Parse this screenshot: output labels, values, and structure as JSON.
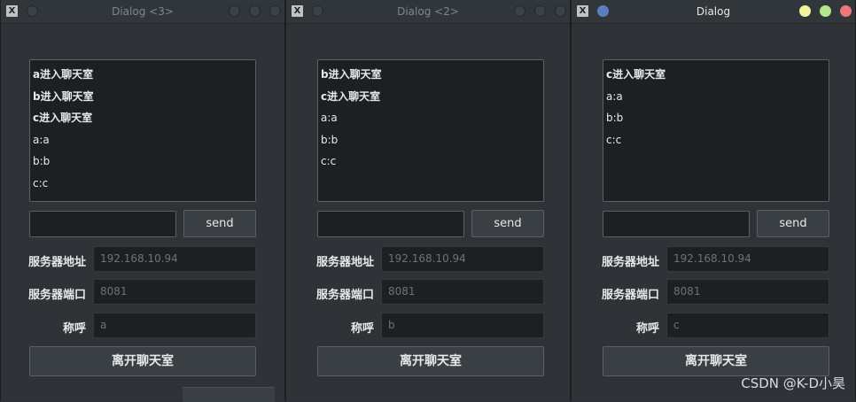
{
  "windows": [
    {
      "title": "Dialog <3>",
      "chat_lines": [
        {
          "text": "a进入聊天室",
          "bold": true
        },
        {
          "text": "b进入聊天室",
          "bold": true
        },
        {
          "text": "c进入聊天室",
          "bold": true
        },
        {
          "text": "a:a",
          "bold": false
        },
        {
          "text": "b:b",
          "bold": false
        },
        {
          "text": "c:c",
          "bold": false
        }
      ],
      "message_value": "",
      "send_label": "send",
      "server_address_label": "服务器地址",
      "server_address_value": "192.168.10.94",
      "server_port_label": "服务器端口",
      "server_port_value": "8081",
      "nickname_label": "称呼",
      "nickname_value": "a",
      "leave_label": "离开聊天室"
    },
    {
      "title": "Dialog <2>",
      "chat_lines": [
        {
          "text": "b进入聊天室",
          "bold": true
        },
        {
          "text": "c进入聊天室",
          "bold": true
        },
        {
          "text": "a:a",
          "bold": false
        },
        {
          "text": "b:b",
          "bold": false
        },
        {
          "text": "c:c",
          "bold": false
        }
      ],
      "message_value": "",
      "send_label": "send",
      "server_address_label": "服务器地址",
      "server_address_value": "192.168.10.94",
      "server_port_label": "服务器端口",
      "server_port_value": "8081",
      "nickname_label": "称呼",
      "nickname_value": "b",
      "leave_label": "离开聊天室"
    },
    {
      "title": "Dialog",
      "chat_lines": [
        {
          "text": "c进入聊天室",
          "bold": true
        },
        {
          "text": "a:a",
          "bold": false
        },
        {
          "text": "b:b",
          "bold": false
        },
        {
          "text": "c:c",
          "bold": false
        }
      ],
      "message_value": "",
      "send_label": "send",
      "server_address_label": "服务器地址",
      "server_address_value": "192.168.10.94",
      "server_port_label": "服务器端口",
      "server_port_value": "8081",
      "nickname_label": "称呼",
      "nickname_value": "c",
      "leave_label": "离开聊天室"
    }
  ],
  "titlebar_icons": {
    "app": "x-window-icon",
    "menu": "circle-menu-icon",
    "minimize": "minimize-icon",
    "maximize": "maximize-icon",
    "close": "close-icon"
  },
  "colors": {
    "active_minimize": "#f4f29c",
    "active_maximize": "#b5e58b",
    "active_close": "#f07777",
    "active_menu": "#5a7fc0"
  },
  "watermark": "CSDN @K-D小昊"
}
